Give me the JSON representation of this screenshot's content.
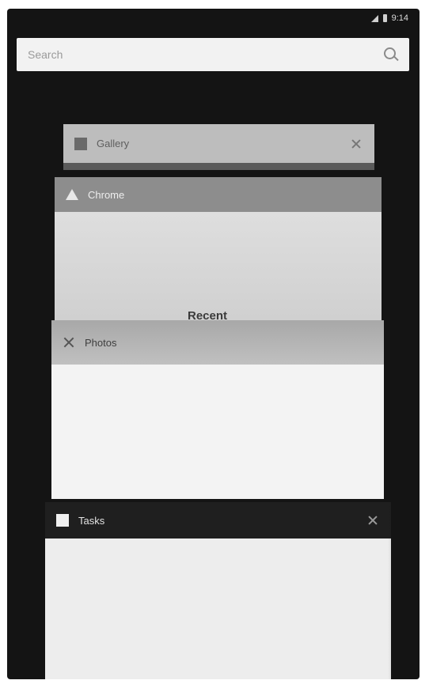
{
  "status_bar": {
    "time": "9:14"
  },
  "search": {
    "placeholder": "Search"
  },
  "recent_apps": [
    {
      "label": "Gallery"
    },
    {
      "label": "Chrome"
    },
    {
      "label": "Photos"
    },
    {
      "label": "Tasks"
    }
  ],
  "overlay_label": "Recent",
  "colors": {
    "background": "#141414",
    "search_bar": "#f2f2f2"
  }
}
